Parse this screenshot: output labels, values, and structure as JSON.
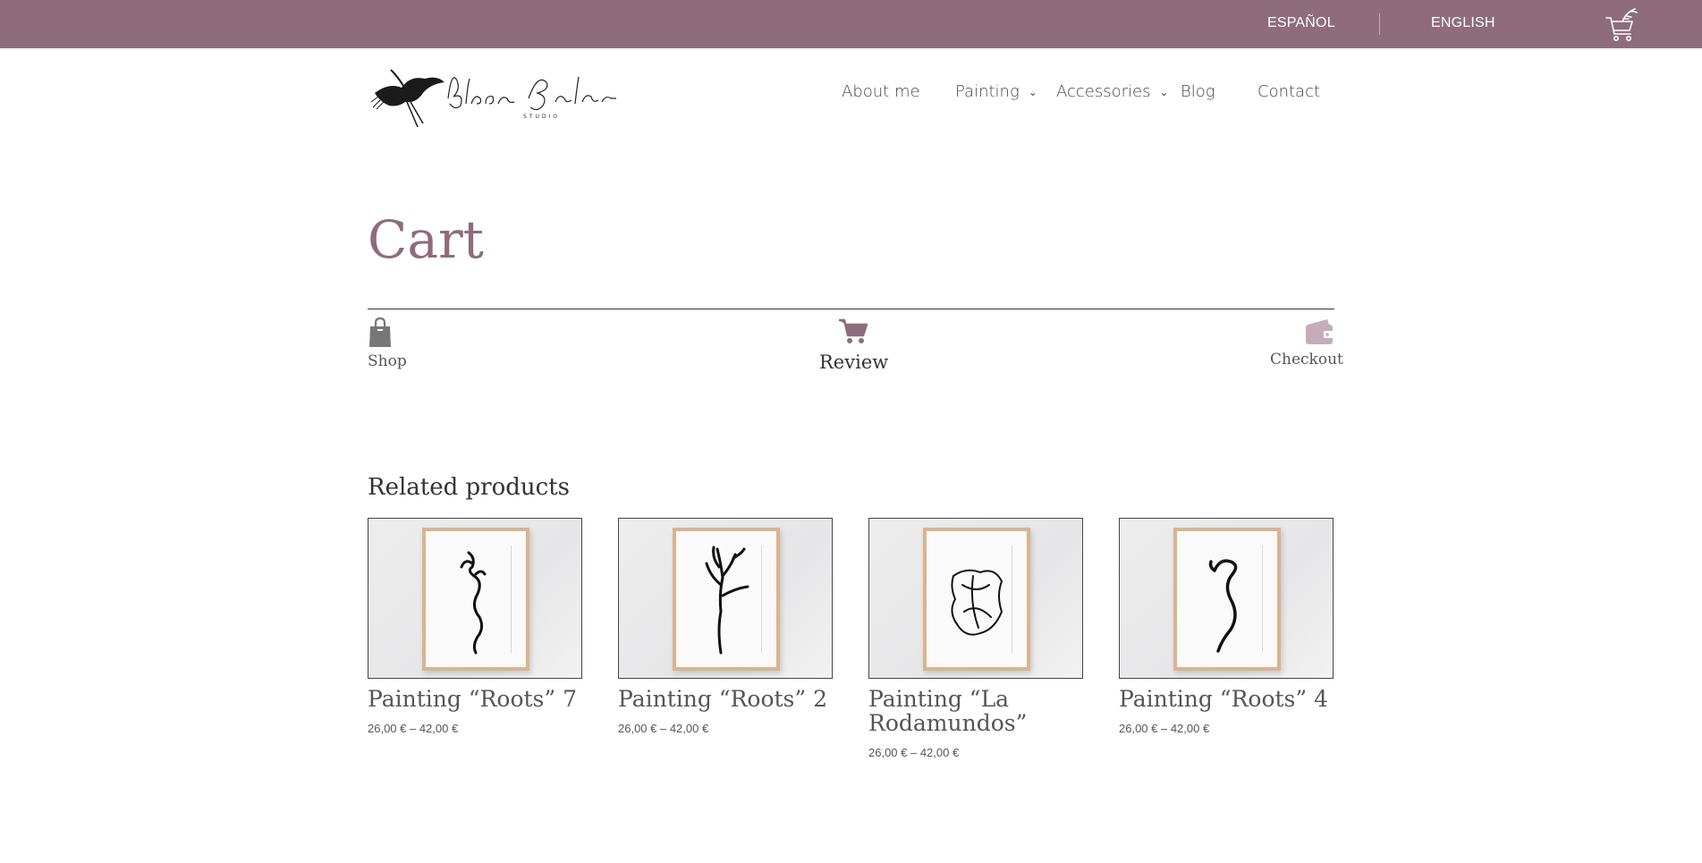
{
  "topbar": {
    "languages": [
      "ESPAÑOL",
      "ENGLISH"
    ],
    "background_color": "#8e6c7c",
    "cart_icon": "shopping-cart-icon"
  },
  "logo": {
    "alt": "Blanca Gálvez Studio",
    "icon": "crane-logo"
  },
  "nav": {
    "items": [
      {
        "label": "About me",
        "has_dropdown": false
      },
      {
        "label": "Painting",
        "has_dropdown": true
      },
      {
        "label": "Accessories",
        "has_dropdown": true
      },
      {
        "label": "Blog",
        "has_dropdown": false
      },
      {
        "label": "Contact",
        "has_dropdown": false
      }
    ],
    "dropdown_icon": "chevron-down-icon"
  },
  "page": {
    "title": "Cart",
    "accent_color": "#8e6c7c"
  },
  "steps": [
    {
      "label": "Shop",
      "icon": "shopping-bag-icon",
      "state": "done"
    },
    {
      "label": "Review",
      "icon": "cart-icon",
      "state": "current"
    },
    {
      "label": "Checkout",
      "icon": "wallet-icon",
      "state": "upcoming"
    }
  ],
  "related": {
    "title": "Related products",
    "products": [
      {
        "name": "Painting “Roots” 7",
        "price": "26,00 € – 42,00 €"
      },
      {
        "name": "Painting “Roots” 2",
        "price": "26,00 € – 42,00 €"
      },
      {
        "name": "Painting “La Rodamundos”",
        "price": "26,00 € – 42,00 €"
      },
      {
        "name": "Painting “Roots” 4",
        "price": "26,00 € – 42,00 €"
      }
    ]
  }
}
